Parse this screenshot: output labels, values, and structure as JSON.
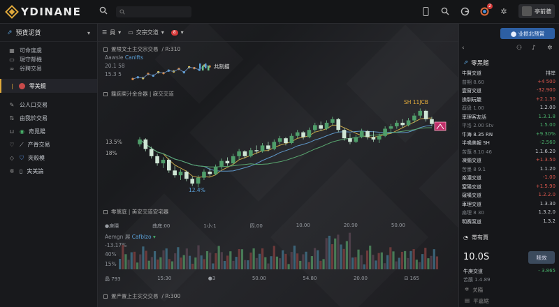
{
  "app": {
    "logo_text": "YDINANE",
    "search_placeholder": ""
  },
  "topbar": {
    "notification_count": "2",
    "user_label": "亭前牆"
  },
  "sidebar": {
    "header": "預貨泥貨",
    "group_items": [
      {
        "label": "可命度虞",
        "icon": "grid-icon"
      },
      {
        "label": "現守鄰機",
        "icon": "folder-icon"
      },
      {
        "label": "谷聘交易",
        "icon": "link-icon"
      }
    ],
    "active_item": "零美鏡",
    "list_items": [
      {
        "label": "公人口交易",
        "icon": "edit-icon"
      },
      {
        "label": "由我於交易",
        "icon": "sort-icon"
      },
      {
        "label": "奇覓陽",
        "icon": "wallet-icon"
      },
      {
        "label": "产脊交易",
        "icon": "heart-icon"
      },
      {
        "label": "夾殼模",
        "icon": "diamond-icon"
      },
      {
        "label": "実美論",
        "icon": "settings-icon"
      }
    ]
  },
  "main": {
    "toolbar": {
      "item1": "員",
      "item2": "交宗交道",
      "badge": "8"
    },
    "section1": {
      "title": "置限文土主交宗交易",
      "suffix": "/ R:310",
      "sub_name": "Aawsle",
      "sub_accent": "Canlfts",
      "v1": "20.1 58",
      "v2": "15.3 5",
      "tag": "共制描"
    },
    "section2": {
      "title": "籠廁柬汁金金器 | 寐交交道",
      "y_top": "13.5%",
      "y_mid": "18%",
      "low_label": "12.4%",
      "high_label": "SH 11JCB"
    },
    "section3": {
      "title": "零黨庭 | 美安交道安宅器",
      "times": [
        "●庚隱",
        "曲底:00",
        "1小:1",
        "四.00",
        "10.00",
        "20.90",
        "50.00"
      ],
      "sub_name": "Aemgn 展",
      "sub_accent": "Cafblzo",
      "p1": "-13.17%",
      "p2": "40%",
      "p3": "15%",
      "bottom": [
        "晶 793",
        "15:30",
        "●3",
        "50.00",
        "54.80",
        "20.00",
        "⊟ 165"
      ]
    },
    "section4": {
      "title": "置产置上主实交交易",
      "suffix": "/ R:300"
    }
  },
  "right": {
    "open_button": "⬤ 业损北预賞",
    "watchlist_title": "零黑餾",
    "rows": [
      {
        "n": "牛賢交道",
        "v": "排岸",
        "c": ""
      },
      {
        "n": "普期 8.60",
        "v": "+4 500",
        "c": "dn",
        "dim": true
      },
      {
        "n": "壹窗交道",
        "v": "-32.900",
        "c": "dn"
      },
      {
        "n": "換馴玩籠",
        "v": "+2.1.30",
        "c": "dn"
      },
      {
        "n": "酉盘 1.00",
        "v": "1.2.00",
        "c": "",
        "dim": true
      },
      {
        "n": "率理客友話",
        "v": "1.3.1.8",
        "c": "up"
      },
      {
        "n": "平洛 2.00 Stv",
        "v": "1.5.00",
        "c": "up",
        "dim": true
      },
      {
        "n": "牛海 8.35 RN",
        "v": "+9.30%",
        "c": "up"
      },
      {
        "n": "半鳴美報 SH",
        "v": "-2.560",
        "c": "up"
      },
      {
        "n": "苦蘸 8.10 46",
        "v": "1.1.6.20",
        "c": "",
        "dim": true
      },
      {
        "n": "凍腦交道",
        "v": "+1.3.50",
        "c": "dn"
      },
      {
        "n": "苦墨 8 9.1",
        "v": "1.1.20",
        "c": "",
        "dim": true
      },
      {
        "n": "楽濃交道",
        "v": "-1.00",
        "c": "dn"
      },
      {
        "n": "窒陽交道",
        "v": "+1.5.90",
        "c": "dn"
      },
      {
        "n": "窺嘆交道",
        "v": "1.2.2.0",
        "c": "dn"
      },
      {
        "n": "車理交道",
        "v": "1.3.30",
        "c": ""
      },
      {
        "n": "扁理 8 30",
        "v": "1.3.2.0",
        "c": "",
        "dim": true
      },
      {
        "n": "明赛泵道",
        "v": "1.3.2",
        "c": ""
      }
    ],
    "positions_title": "帯有賈",
    "positions_value": "10.0S",
    "positions_button": "賬效",
    "pos_row_name": "牛庚交道",
    "pos_row_val": "- 3.865",
    "pos_row2": "苦蘸 1.4.89",
    "pos_section": "关臨",
    "pos_section2": "平嘉縮"
  },
  "chart_data": {
    "type": "candlestick",
    "title": "籠廁柬汁金金器 | 寐交交道",
    "y_ticks": [
      "13.5%",
      "18%"
    ],
    "annotations": [
      "12.4%",
      "SH 11JCB"
    ],
    "candles": [
      [
        4.0,
        4.6,
        3.8,
        4.4
      ],
      [
        4.4,
        4.5,
        3.4,
        3.6
      ],
      [
        3.6,
        3.8,
        2.8,
        3.0
      ],
      [
        3.0,
        3.2,
        2.2,
        2.4
      ],
      [
        2.4,
        2.9,
        2.0,
        2.7
      ],
      [
        2.7,
        2.8,
        1.6,
        1.8
      ],
      [
        1.8,
        2.2,
        1.2,
        1.4
      ],
      [
        1.4,
        1.9,
        1.0,
        1.7
      ],
      [
        1.7,
        1.8,
        0.9,
        1.1
      ],
      [
        1.1,
        1.3,
        0.5,
        0.7
      ],
      [
        0.7,
        1.4,
        0.4,
        1.2
      ],
      [
        1.2,
        1.9,
        1.0,
        1.7
      ],
      [
        1.7,
        2.0,
        1.3,
        1.5
      ],
      [
        1.5,
        2.3,
        1.4,
        2.1
      ],
      [
        2.1,
        2.8,
        1.9,
        2.6
      ],
      [
        2.6,
        2.9,
        2.2,
        2.4
      ],
      [
        2.4,
        3.2,
        2.3,
        3.0
      ],
      [
        3.0,
        3.6,
        2.7,
        3.4
      ],
      [
        3.4,
        3.5,
        2.8,
        3.0
      ],
      [
        3.0,
        3.7,
        2.9,
        3.5
      ],
      [
        3.5,
        3.9,
        3.2,
        3.4
      ],
      [
        3.4,
        4.1,
        3.3,
        3.9
      ],
      [
        3.9,
        4.2,
        3.4,
        3.6
      ],
      [
        3.6,
        4.4,
        3.5,
        4.2
      ],
      [
        4.2,
        4.7,
        4.0,
        4.5
      ],
      [
        4.5,
        4.6,
        3.9,
        4.1
      ],
      [
        4.1,
        4.9,
        4.0,
        4.7
      ],
      [
        4.7,
        5.2,
        4.5,
        5.0
      ],
      [
        5.0,
        5.1,
        4.4,
        4.6
      ],
      [
        4.6,
        5.4,
        4.5,
        5.2
      ],
      [
        5.2,
        5.8,
        5.0,
        5.6
      ],
      [
        5.6,
        5.9,
        5.1,
        5.3
      ],
      [
        5.3,
        6.0,
        5.2,
        5.8
      ],
      [
        5.8,
        6.3,
        5.6,
        6.1
      ],
      [
        6.1,
        6.2,
        5.0,
        5.2
      ],
      [
        5.2,
        5.4,
        4.3,
        4.5
      ],
      [
        4.5,
        4.9,
        4.0,
        4.2
      ],
      [
        4.2,
        4.8,
        4.1,
        4.6
      ],
      [
        4.6,
        5.3,
        4.5,
        5.1
      ],
      [
        5.1,
        5.2,
        4.4,
        4.6
      ],
      [
        4.6,
        5.1,
        4.2,
        4.4
      ],
      [
        4.4,
        4.9,
        4.1,
        4.7
      ],
      [
        4.7,
        5.5,
        4.6,
        5.3
      ],
      [
        5.3,
        5.7,
        5.0,
        5.5
      ],
      [
        5.5,
        6.0,
        5.3,
        5.8
      ],
      [
        5.8,
        6.1,
        5.4,
        5.6
      ],
      [
        5.6,
        6.2,
        5.5,
        6.0
      ],
      [
        6.0,
        6.6,
        5.8,
        6.4
      ],
      [
        6.4,
        7.0,
        6.2,
        6.8
      ],
      [
        6.8,
        6.9,
        5.9,
        6.1
      ],
      [
        6.1,
        6.3,
        5.5,
        5.7
      ]
    ]
  }
}
